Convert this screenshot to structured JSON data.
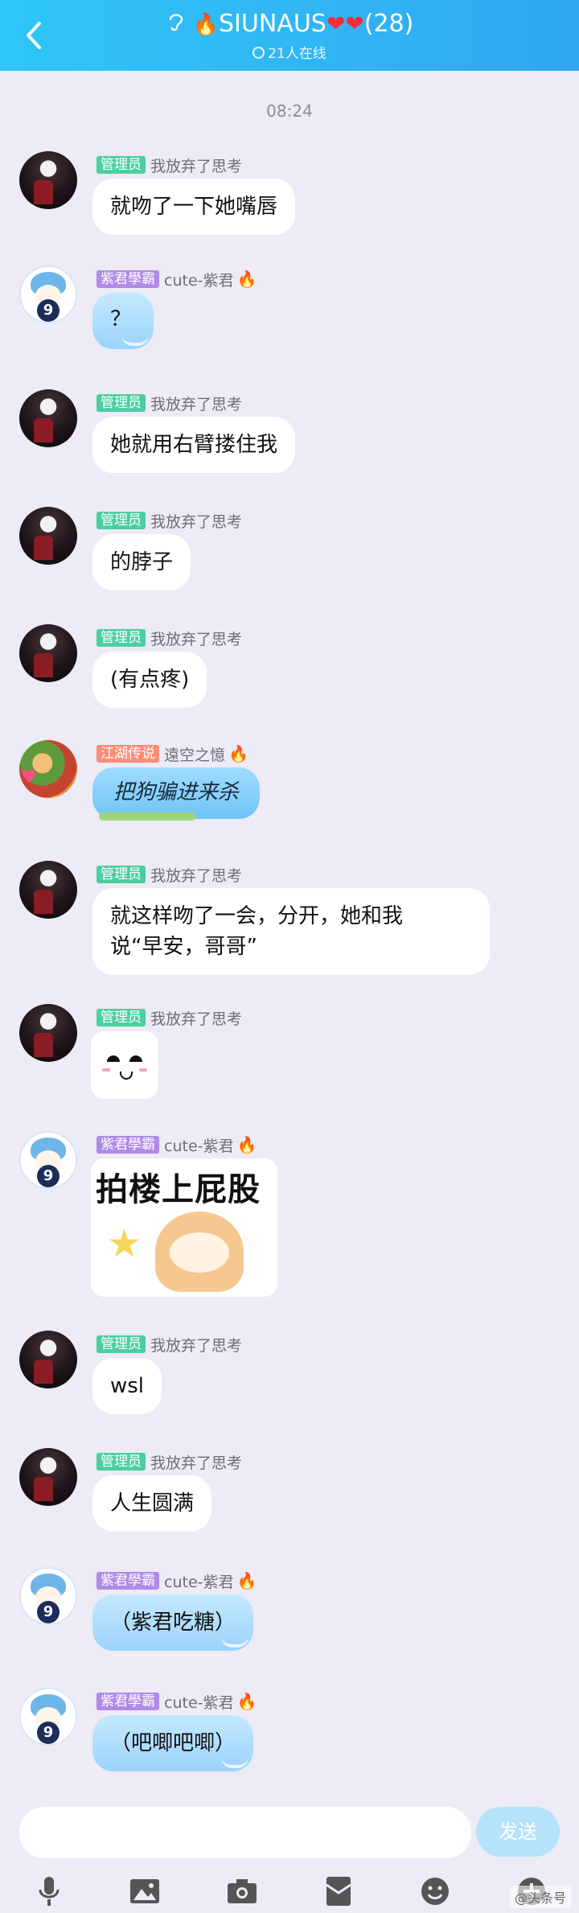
{
  "header": {
    "title_prefix": "SIUNAUS",
    "title_hearts": "❤❤",
    "title_count": "(28)",
    "online": "21人在线",
    "accent": "#2fb4f4"
  },
  "timestamp": "08:24",
  "messages": [
    {
      "badge": "管理员",
      "nick": "我放弃了思考",
      "text": "就吻了一下她嘴唇"
    },
    {
      "badge": "紫君學霸",
      "nick": "cute-紫君",
      "text": "？"
    },
    {
      "badge": "管理员",
      "nick": "我放弃了思考",
      "text": "她就用右臂搂住我"
    },
    {
      "badge": "管理员",
      "nick": "我放弃了思考",
      "text": "的脖子"
    },
    {
      "badge": "管理员",
      "nick": "我放弃了思考",
      "text": "(有点疼)"
    },
    {
      "badge": "江湖传说",
      "nick": "遠空之憶",
      "text": "把狗骗进来杀"
    },
    {
      "badge": "管理员",
      "nick": "我放弃了思考",
      "text": "就这样吻了一会，分开，她和我\n说“早安，哥哥”"
    },
    {
      "badge": "管理员",
      "nick": "我放弃了思考",
      "sticker": "smirk-face-sticker"
    },
    {
      "badge": "紫君學霸",
      "nick": "cute-紫君",
      "sticker_text": "拍楼上屁股"
    },
    {
      "badge": "管理员",
      "nick": "我放弃了思考",
      "text": "wsl"
    },
    {
      "badge": "管理员",
      "nick": "我放弃了思考",
      "text": "人生圆满"
    },
    {
      "badge": "紫君學霸",
      "nick": "cute-紫君",
      "text": "（紫君吃糖）"
    },
    {
      "badge": "紫君學霸",
      "nick": "cute-紫君",
      "text": "（吧唧吧唧）"
    }
  ],
  "input": {
    "placeholder": "",
    "send_label": "发送"
  },
  "toolbar": [
    "microphone-icon",
    "image-icon",
    "camera-icon",
    "red-packet-icon",
    "emoji-icon",
    "plus-icon"
  ],
  "watermark": "@头条号"
}
